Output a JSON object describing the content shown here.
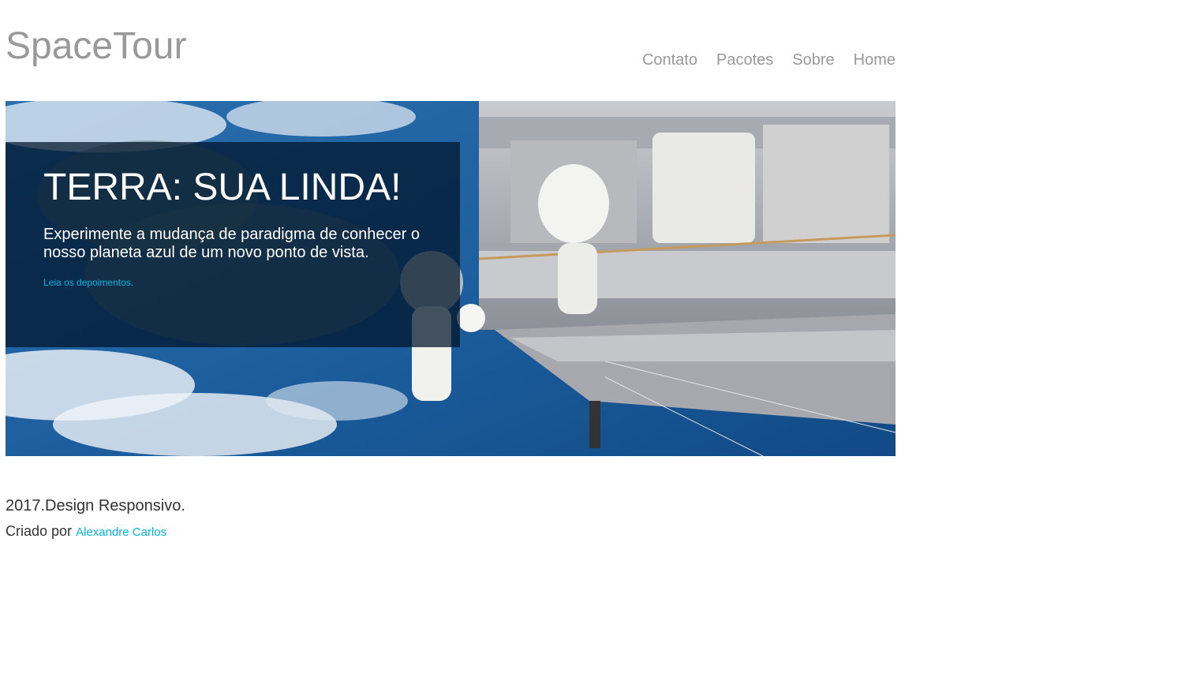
{
  "header": {
    "logo": "SpaceTour",
    "nav": [
      {
        "label": "Contato"
      },
      {
        "label": "Pacotes"
      },
      {
        "label": "Sobre"
      },
      {
        "label": "Home"
      }
    ]
  },
  "hero": {
    "title": "TERRA: SUA LINDA!",
    "text": "Experimente a mudança de paradigma de conhecer o nosso planeta azul de um novo ponto de vista.",
    "link": "Leia os depoimentos."
  },
  "footer": {
    "line1": "2017.Design Responsivo.",
    "created_by": "Criado por",
    "author": "Alexandre Carlos"
  },
  "colors": {
    "logo": "#999999",
    "nav": "#999999",
    "link": "#00b4e6",
    "footer_text": "#333333",
    "overlay": "#001428"
  }
}
